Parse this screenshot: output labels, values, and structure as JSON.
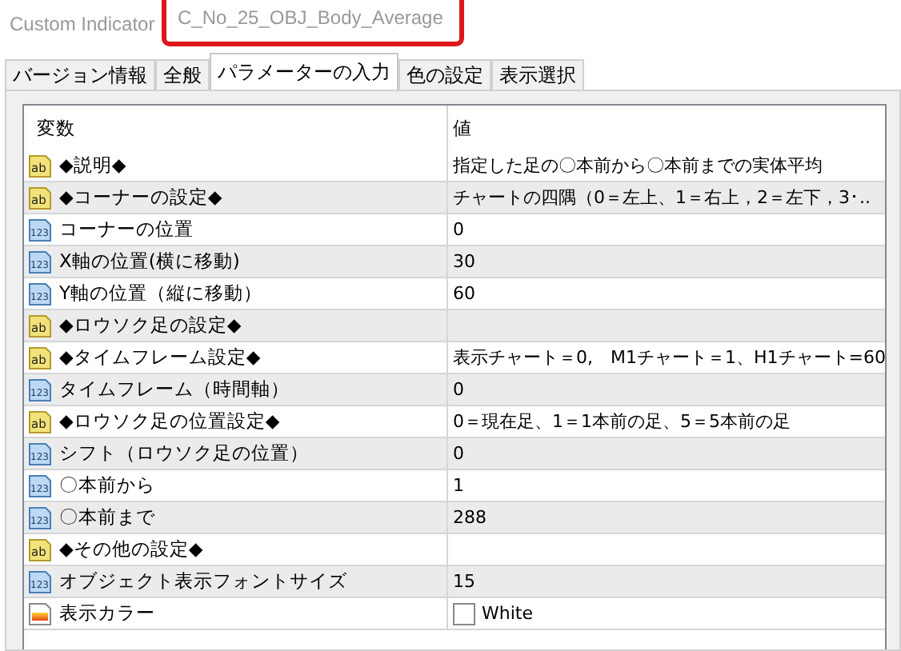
{
  "window": {
    "title": "Custom Indicator",
    "name": "C_No_25_OBJ_Body_Average",
    "name_highlighted": true
  },
  "tabs": [
    {
      "label": "バージョン情報",
      "selected": false
    },
    {
      "label": "全般",
      "selected": false
    },
    {
      "label": "パラメーターの入力",
      "selected": true
    },
    {
      "label": "色の設定",
      "selected": false
    },
    {
      "label": "表示選択",
      "selected": false
    }
  ],
  "table": {
    "columns": [
      "変数",
      "値"
    ],
    "rows": [
      {
        "kind": "string",
        "type_label": "ab",
        "name": "◆説明◆",
        "value": "指定した足の〇本前から〇本前までの実体平均"
      },
      {
        "kind": "string",
        "type_label": "ab",
        "name": "◆コーナーの設定◆",
        "value": "チャートの四隅（0＝左上、1＝右上，2＝左下，3･.."
      },
      {
        "kind": "int",
        "type_label": "123",
        "name": "コーナーの位置",
        "value": "0"
      },
      {
        "kind": "int",
        "type_label": "123",
        "name": "X軸の位置(横に移動)",
        "value": "30"
      },
      {
        "kind": "int",
        "type_label": "123",
        "name": "Y軸の位置（縦に移動）",
        "value": "60"
      },
      {
        "kind": "string",
        "type_label": "ab",
        "name": "◆ロウソク足の設定◆"
      },
      {
        "kind": "string",
        "type_label": "ab",
        "name": "◆タイムフレーム設定◆",
        "value": "表示チャート＝0,　M1チャート＝1、H1チャート=60"
      },
      {
        "kind": "int",
        "type_label": "123",
        "name": "タイムフレーム（時間軸）",
        "value": "0"
      },
      {
        "kind": "string",
        "type_label": "ab",
        "name": "◆ロウソク足の位置設定◆",
        "value": "0＝現在足、1＝1本前の足、5＝5本前の足"
      },
      {
        "kind": "int",
        "type_label": "123",
        "name": "シフト（ロウソク足の位置）",
        "value": "0"
      },
      {
        "kind": "int",
        "type_label": "123",
        "name": "〇本前から",
        "value": "1"
      },
      {
        "kind": "int",
        "type_label": "123",
        "name": "〇本前まで",
        "value": "288"
      },
      {
        "kind": "string",
        "type_label": "ab",
        "name": "◆その他の設定◆"
      },
      {
        "kind": "int",
        "type_label": "123",
        "name": "オブジェクト表示フォントサイズ",
        "value": "15"
      },
      {
        "kind": "color",
        "name": "表示カラー",
        "value": "White",
        "color": "#ffffff"
      }
    ]
  }
}
